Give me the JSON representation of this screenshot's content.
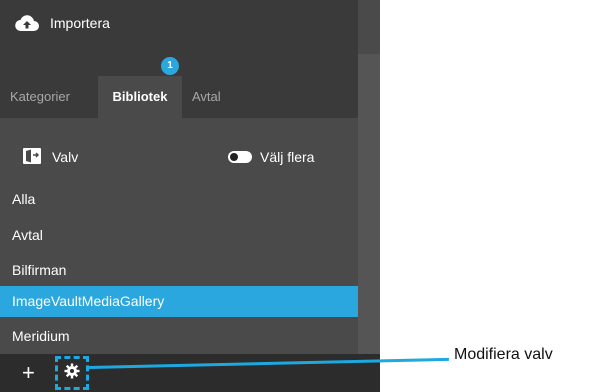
{
  "header": {
    "import_label": "Importera"
  },
  "tabs": [
    {
      "label": "Kategorier"
    },
    {
      "label": "Bibliotek",
      "badge": "1"
    },
    {
      "label": "Avtal"
    }
  ],
  "vault_row": {
    "label": "Valv",
    "toggle_label": "Välj flera"
  },
  "vault_list": [
    {
      "label": "Alla"
    },
    {
      "label": "Avtal"
    },
    {
      "label": "Bilfirman"
    },
    {
      "label": "ImageVaultMediaGallery"
    },
    {
      "label": "Meridium"
    }
  ],
  "footer": {
    "plus": "+"
  },
  "callout": {
    "label": "Modifiera valv"
  },
  "colors": {
    "accent": "#2aa7de",
    "panel": "#4a4a4a",
    "dark": "#3a3a3a"
  }
}
